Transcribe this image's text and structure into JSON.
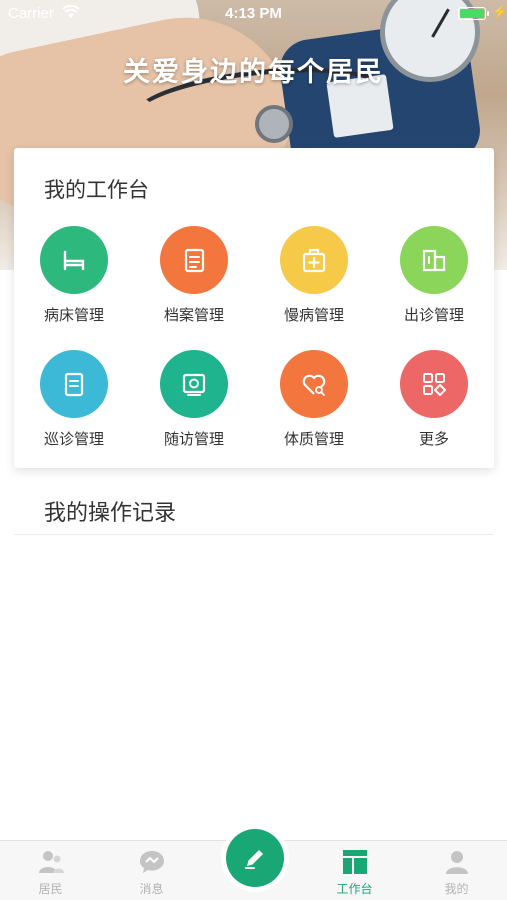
{
  "status_bar": {
    "carrier": "Carrier",
    "time": "4:13 PM"
  },
  "hero": {
    "title": "关爱身边的每个居民"
  },
  "workbench": {
    "title": "我的工作台",
    "items": [
      {
        "label": "病床管理",
        "icon": "bed-icon",
        "color": "#2db87d"
      },
      {
        "label": "档案管理",
        "icon": "document-icon",
        "color": "#f2763e"
      },
      {
        "label": "慢病管理",
        "icon": "medical-kit-icon",
        "color": "#f7c948"
      },
      {
        "label": "出诊管理",
        "icon": "building-icon",
        "color": "#8bd65a"
      },
      {
        "label": "巡诊管理",
        "icon": "note-icon",
        "color": "#3bb9d6"
      },
      {
        "label": "随访管理",
        "icon": "refresh-box-icon",
        "color": "#1fb48d"
      },
      {
        "label": "体质管理",
        "icon": "heart-search-icon",
        "color": "#f2763e"
      },
      {
        "label": "更多",
        "icon": "grid-more-icon",
        "color": "#ee6767"
      }
    ]
  },
  "records": {
    "title": "我的操作记录"
  },
  "tab_bar": {
    "tabs": [
      {
        "label": "居民",
        "icon": "residents-icon"
      },
      {
        "label": "消息",
        "icon": "message-icon"
      },
      {
        "label": "工作台",
        "icon": "workbench-icon",
        "active": true
      },
      {
        "label": "我的",
        "icon": "profile-icon"
      }
    ],
    "fab_icon": "edit-pencil-icon",
    "accent_color": "#1aa776",
    "inactive_color": "#b3b3b3"
  }
}
